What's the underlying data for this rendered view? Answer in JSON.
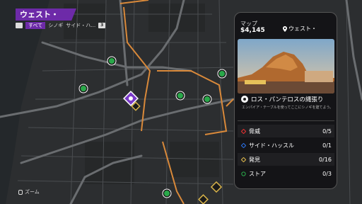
{
  "header": {
    "region_name": "ウェスト・",
    "lb_key": "",
    "rb_key": "3",
    "filters": [
      {
        "label": "すべて",
        "active": true
      },
      {
        "label": "シノギ",
        "active": false
      },
      {
        "label": "サイド・ハ…",
        "active": false
      }
    ]
  },
  "footer": {
    "zoom_label": "ズーム"
  },
  "panel": {
    "tab_title": "マップ",
    "money": "$4,145",
    "location": "ウェスト・",
    "activity_name": "ロス・パンテロスの縄張り",
    "activity_desc": "エンパイア・テーブルを使ってここにシノギを建てよう。",
    "stats": [
      {
        "label": "脅威",
        "count": "0/5",
        "color": "#e03030",
        "icon": "threat-diamond-icon"
      },
      {
        "label": "サイド・ハッスル",
        "count": "0/1",
        "color": "#2a6ee0",
        "icon": "side-hustle-diamond-icon"
      },
      {
        "label": "発見",
        "count": "0/16",
        "color": "#d8b34a",
        "icon": "discovery-diamond-icon"
      },
      {
        "label": "ストア",
        "count": "0/3",
        "color": "#2aa84a",
        "icon": "store-circle-icon"
      }
    ]
  }
}
